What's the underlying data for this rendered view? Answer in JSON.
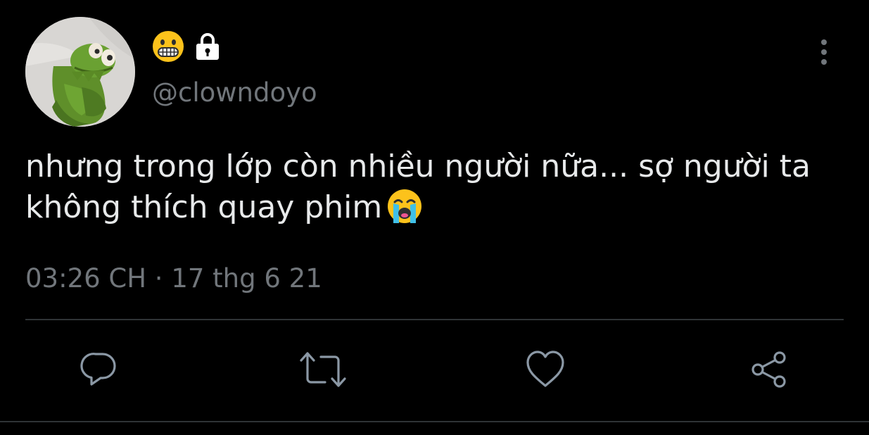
{
  "tweet": {
    "author": {
      "display_name_icons": [
        "grimacing-face-emoji",
        "lock-icon"
      ],
      "handle": "@clowndoyo",
      "avatar": "kermit-frog-avatar"
    },
    "text": "nhưng trong lớp còn nhiều người nữa... sợ người ta không thích quay phim",
    "text_emoji": "loudly-crying-face-emoji",
    "timestamp": "03:26 CH · 17 thg 6 21"
  },
  "actions": [
    {
      "name": "reply",
      "icon": "reply-icon"
    },
    {
      "name": "retweet",
      "icon": "retweet-icon"
    },
    {
      "name": "like",
      "icon": "heart-icon"
    },
    {
      "name": "share",
      "icon": "share-icon"
    }
  ],
  "menu": {
    "icon": "more-vertical-icon"
  },
  "colors": {
    "background": "#000000",
    "text": "#e7e9ea",
    "secondary_text": "#71767b",
    "divider": "#2f3336",
    "icon": "#8b98a5"
  }
}
